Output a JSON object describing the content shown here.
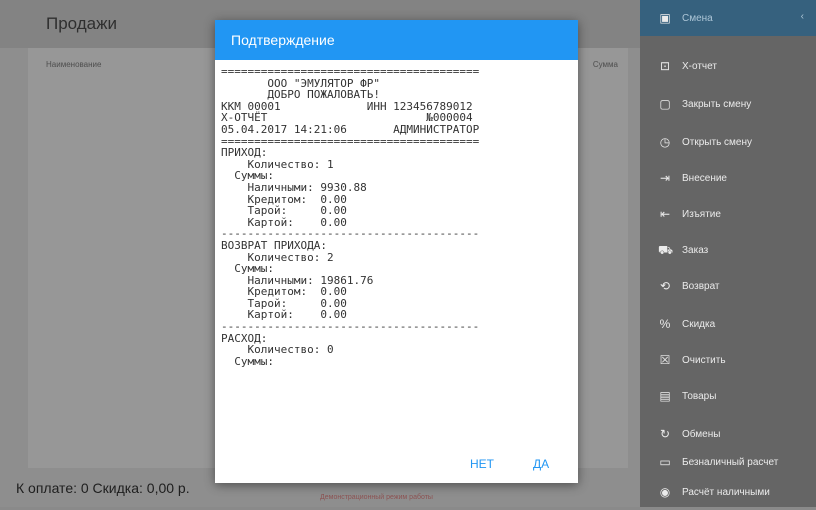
{
  "main": {
    "title": "Продажи",
    "columns": {
      "name": "Наименование",
      "sum": "Сумма"
    },
    "footer": {
      "pay": "К оплате: 0 Скидка: 0,00 р.",
      "demo": "Демонстрационный режим работы"
    }
  },
  "sidebar": {
    "items": [
      {
        "label": "Смена",
        "icon": "calendar-icon"
      },
      {
        "label": "X-отчет",
        "icon": "report-icon"
      },
      {
        "label": "Закрыть смену",
        "icon": "close-shift-icon"
      },
      {
        "label": "Открыть смену",
        "icon": "clock-icon"
      },
      {
        "label": "Внесение",
        "icon": "login-icon"
      },
      {
        "label": "Изъятие",
        "icon": "logout-icon"
      },
      {
        "label": "Заказ",
        "icon": "cart-icon"
      },
      {
        "label": "Возврат",
        "icon": "return-icon"
      },
      {
        "label": "Скидка",
        "icon": "percent-icon"
      },
      {
        "label": "Очистить",
        "icon": "clear-icon"
      },
      {
        "label": "Товары",
        "icon": "goods-icon"
      },
      {
        "label": "Обмены",
        "icon": "refresh-icon"
      },
      {
        "label": "Безналичный расчет",
        "icon": "card-icon"
      },
      {
        "label": "Расчёт наличными",
        "icon": "cash-icon"
      }
    ]
  },
  "dialog": {
    "title": "Подтверждение",
    "receipt": "=======================================\n       ООО \"ЭМУЛЯТОР ФР\"\n       ДОБРО ПОЖАЛОВАТЬ!\nККМ 00001             ИНН 123456789012\nX-ОТЧЁТ                        №000004\n05.04.2017 14:21:06       АДМИНИСТРАТОР\n=======================================\nПРИХОД:\n    Количество: 1\n  Суммы:\n    Наличными: 9930.88\n    Кредитом:  0.00\n    Тарой:     0.00\n    Картой:    0.00\n---------------------------------------\nВОЗВРАТ ПРИХОДА:\n    Количество: 2\n  Суммы:\n    Наличными: 19861.76\n    Кредитом:  0.00\n    Тарой:     0.00\n    Картой:    0.00\n---------------------------------------\nРАСХОД:\n    Количество: 0\n  Суммы:",
    "no": "НЕТ",
    "yes": "ДА"
  }
}
